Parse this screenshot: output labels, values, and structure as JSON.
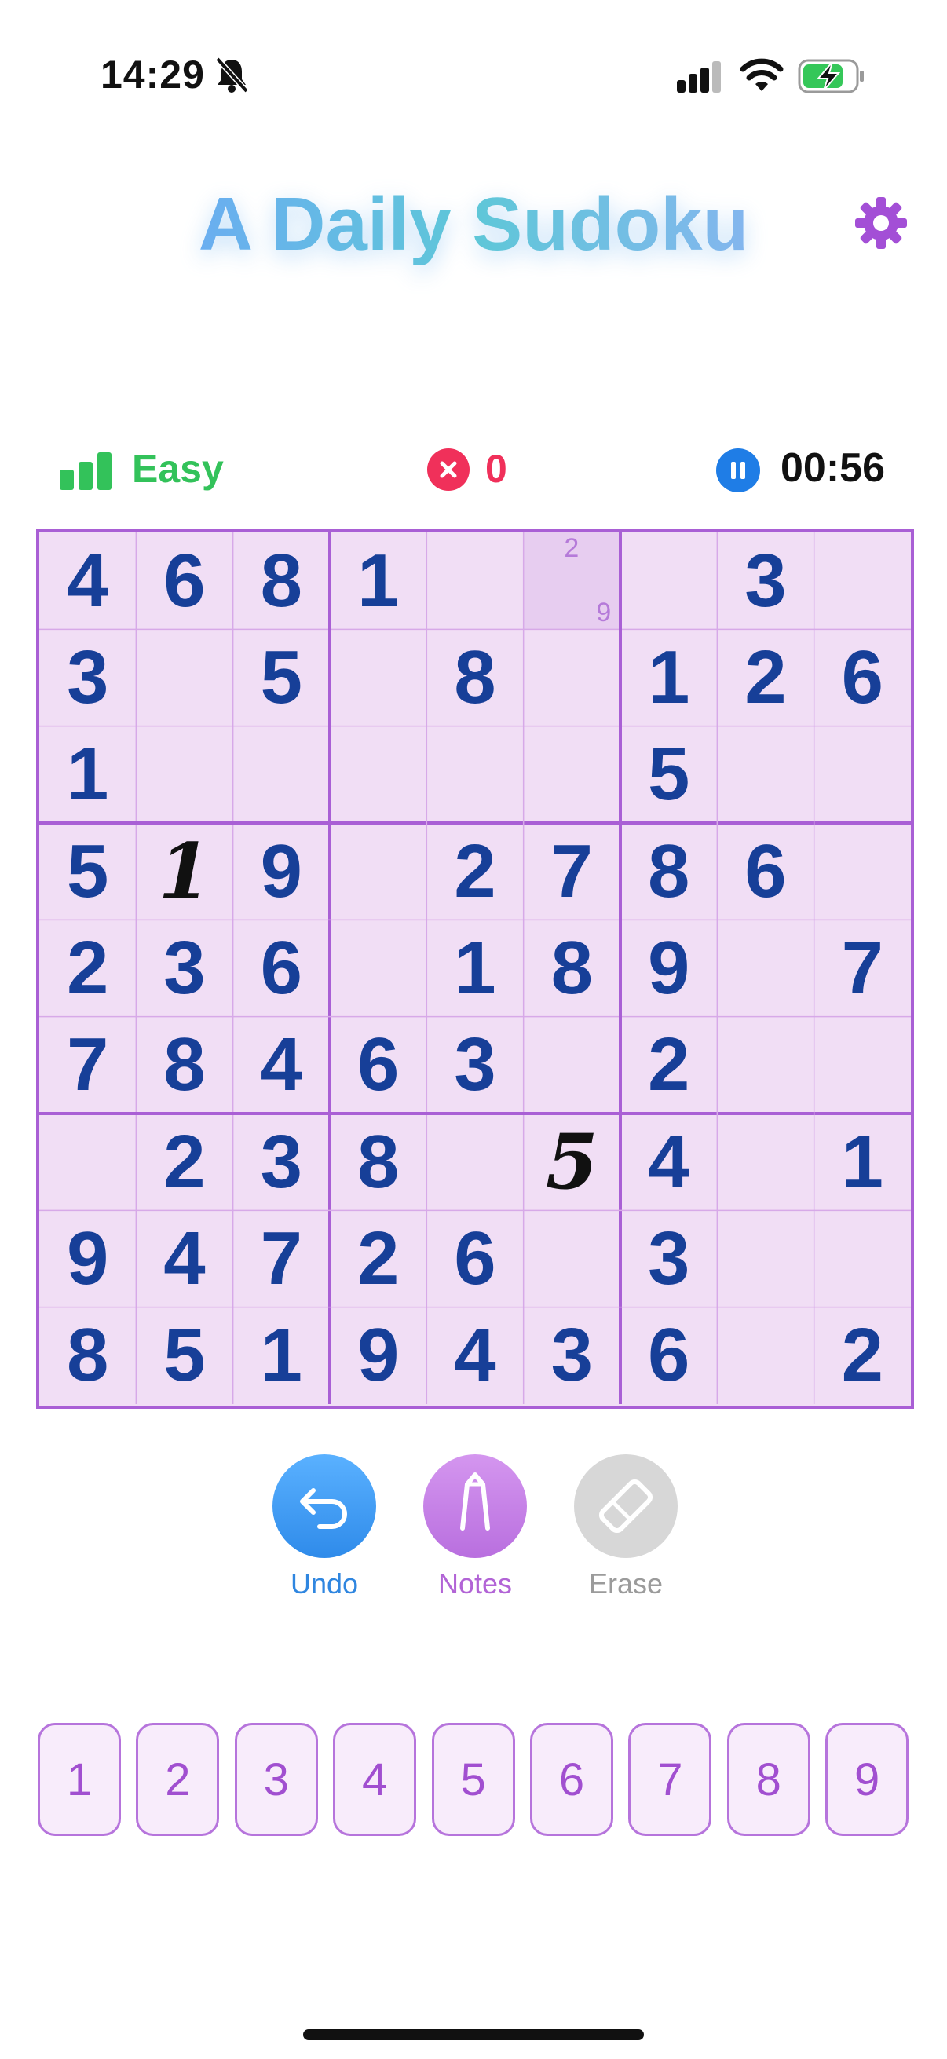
{
  "status_bar": {
    "time": "14:29"
  },
  "header": {
    "title": "A Daily Sudoku"
  },
  "info": {
    "difficulty": "Easy",
    "mistakes": "0",
    "timer": "00:56"
  },
  "colors": {
    "accent": "#a95fd5",
    "given_digit": "#173f98",
    "easy": "#33c25a",
    "error": "#f0305a",
    "timer_button": "#1f7de6"
  },
  "board": {
    "rows": [
      [
        "4",
        "6",
        "8",
        "1",
        "",
        "",
        "",
        "3",
        ""
      ],
      [
        "3",
        "",
        "5",
        "",
        "8",
        "",
        "1",
        "2",
        "6"
      ],
      [
        "1",
        "",
        "",
        "",
        "",
        "",
        "5",
        "",
        ""
      ],
      [
        "5",
        "1",
        "9",
        "",
        "2",
        "7",
        "8",
        "6",
        ""
      ],
      [
        "2",
        "3",
        "6",
        "",
        "1",
        "8",
        "9",
        "",
        "7"
      ],
      [
        "7",
        "8",
        "4",
        "6",
        "3",
        "",
        "2",
        "",
        ""
      ],
      [
        "",
        "2",
        "3",
        "8",
        "",
        "5",
        "4",
        "",
        "1"
      ],
      [
        "9",
        "4",
        "7",
        "2",
        "6",
        "",
        "3",
        "",
        ""
      ],
      [
        "8",
        "5",
        "1",
        "9",
        "4",
        "3",
        "6",
        "",
        "2"
      ]
    ],
    "user_entries": [
      [
        3,
        1
      ],
      [
        6,
        5
      ]
    ],
    "selected_cell": [
      0,
      5
    ],
    "notes": [
      {
        "row": 0,
        "col": 5,
        "digit": "2",
        "slot": 2
      },
      {
        "row": 0,
        "col": 5,
        "digit": "9",
        "slot": 9
      }
    ]
  },
  "tools": {
    "undo": "Undo",
    "notes": "Notes",
    "erase": "Erase"
  },
  "numpad": [
    "1",
    "2",
    "3",
    "4",
    "5",
    "6",
    "7",
    "8",
    "9"
  ],
  "icons": {
    "mute": "bell-slash-icon",
    "signal": "cellular-signal-icon",
    "wifi": "wifi-icon",
    "battery": "battery-charging-icon",
    "settings": "gear-icon",
    "difficulty": "bar-chart-icon",
    "mistakes": "x-circle-icon",
    "pause": "pause-icon",
    "undo": "undo-arrow-icon",
    "notes": "pencil-icon",
    "erase": "eraser-icon"
  }
}
